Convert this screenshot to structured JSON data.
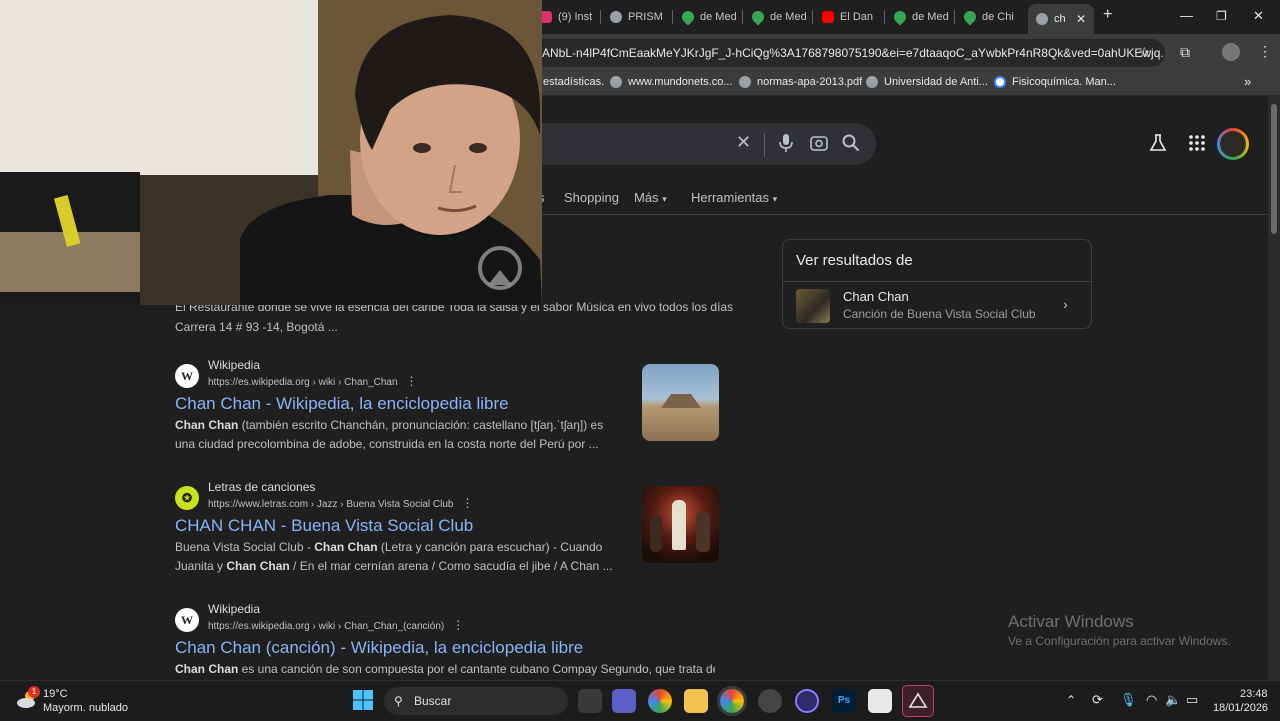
{
  "browser": {
    "tabs": [
      {
        "label": "(9) Inst",
        "color": "#e1306c"
      },
      {
        "label": "PRISM",
        "color": "#9aa0a6"
      },
      {
        "label": "de Med",
        "color": "#34a853"
      },
      {
        "label": "de Med",
        "color": "#34a853"
      },
      {
        "label": "El Dan",
        "color": "#ff0000"
      },
      {
        "label": "de Med",
        "color": "#34a853"
      },
      {
        "label": "de Chi",
        "color": "#34a853"
      },
      {
        "label": "ch",
        "color": "#9aa0a6",
        "active": true
      }
    ],
    "new_tab": "+",
    "url": "ANbL-n4lP4fCmEaakMeYJKrJgF_J-hCiQg%3A1768798075190&ei=e7dtaaqoC_aYwbkPr4nR8Qk&ved=0ahUKEwjq...",
    "bookmarks": [
      "estadísticas.",
      "www.mundonets.co...",
      "normas-apa-2013.pdf",
      "Universidad de Anti...",
      "Fisicoquímica. Man..."
    ]
  },
  "search": {
    "nav_tabs": [
      "s",
      "Shopping",
      "Más",
      "Herramientas"
    ]
  },
  "top_snippet": {
    "line1": "El Restaurante donde se vive la esencia del caribe Toda la salsa y el sabor Música en vivo todos los días",
    "line2": "Carrera 14 # 93 -14, Bogotá ..."
  },
  "results": [
    {
      "site": "Wikipedia",
      "url": "https://es.wikipedia.org › wiki › Chan_Chan",
      "title": "Chan Chan - Wikipedia, la enciclopedia libre",
      "snippet_bold": "Chan Chan",
      "snippet_rest": " (también escrito Chanchán, pronunciación: castellano [tʃaŋ.ˈtʃaŋ]) es una ciudad precolombina de adobe, construida en la costa norte del Perú por ..."
    },
    {
      "site": "Letras de canciones",
      "url": "https://www.letras.com › Jazz › Buena Vista Social Club",
      "title": "CHAN CHAN - Buena Vista Social Club",
      "snippet_a": "Buena Vista Social Club - ",
      "snippet_b1": "Chan Chan",
      "snippet_c": " (Letra y canción para escuchar) - Cuando Juanita y ",
      "snippet_b2": "Chan Chan",
      "snippet_d": " / En el mar cernían arena / Como sacudía el jibe / A Chan ..."
    },
    {
      "site": "Wikipedia",
      "url": "https://es.wikipedia.org › wiki › Chan_Chan_(canción)",
      "title": "Chan Chan (canción) - Wikipedia, la enciclopedia libre",
      "snippet_bold": "Chan Chan",
      "snippet_rest": " es una canción de son compuesta por el cantante cubano Compay Segundo, que trata de"
    }
  ],
  "side_panel": {
    "header": "Ver resultados de",
    "title": "Chan Chan",
    "subtitle": "Canción de Buena Vista Social Club"
  },
  "activation": {
    "line1": "Activar Windows",
    "line2": "Ve a Configuración para activar Windows."
  },
  "taskbar": {
    "weather_temp": "19°C",
    "weather_desc": "Mayorm. nublado",
    "weather_badge": "1",
    "search_placeholder": "Buscar",
    "time": "23:48",
    "date": "18/01/2026"
  }
}
